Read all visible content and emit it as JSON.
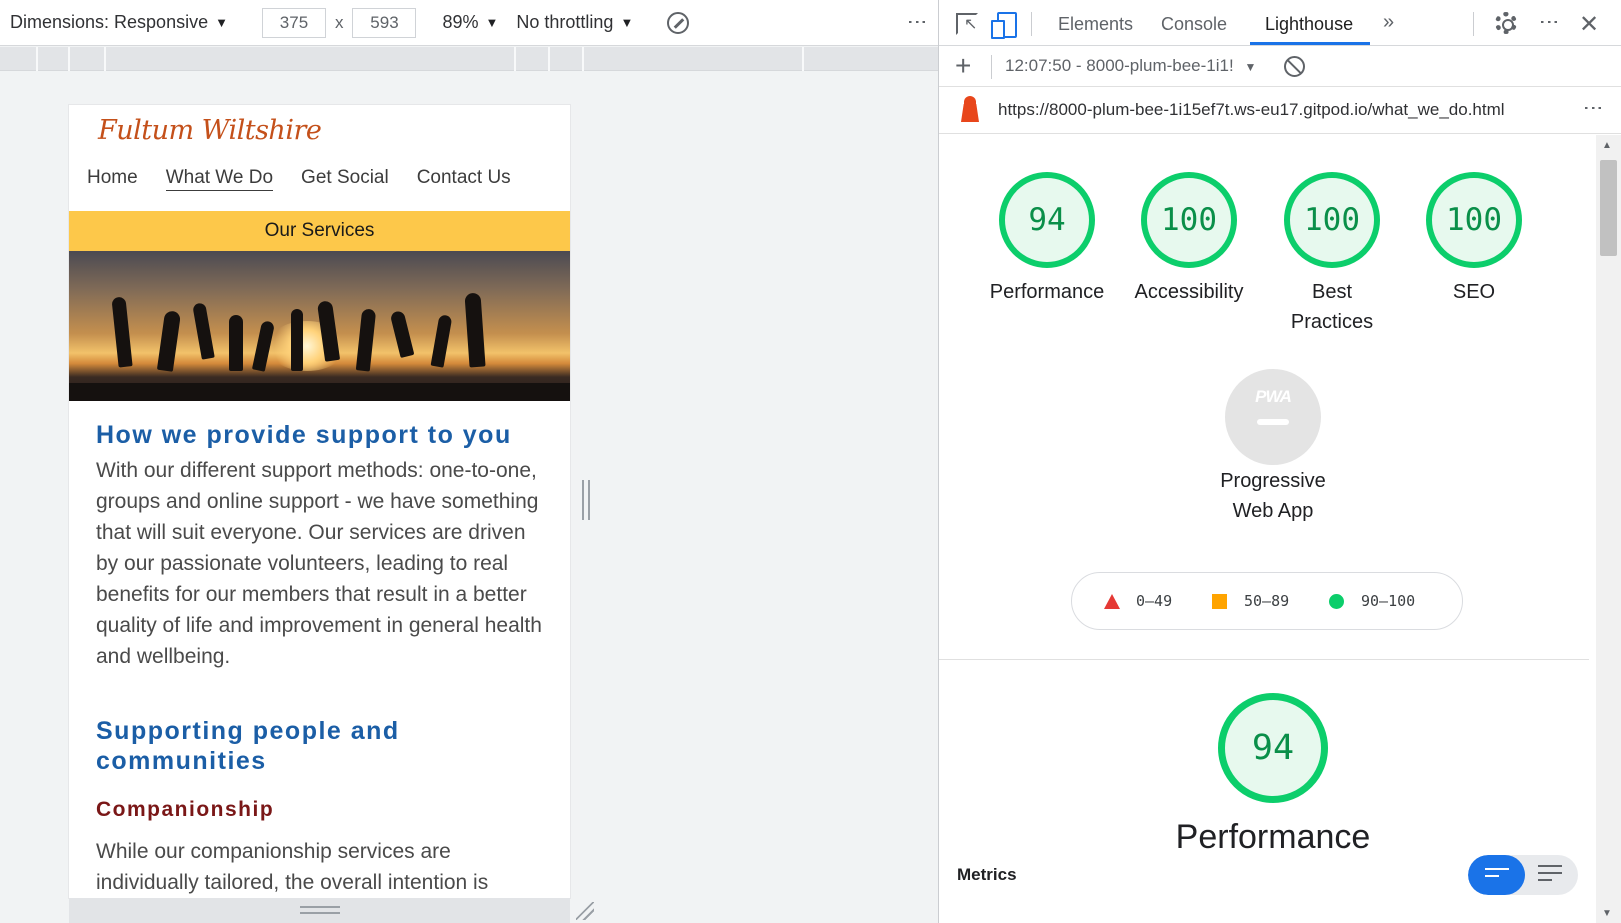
{
  "toolbar": {
    "dimensions_label": "Dimensions: Responsive",
    "width": "375",
    "times": "x",
    "height": "593",
    "zoom": "89%",
    "throttling": "No throttling",
    "caret": "▼",
    "more_icon": "⋮"
  },
  "site": {
    "brand": "Fultum Wiltshire",
    "nav": [
      "Home",
      "What We Do",
      "Get Social",
      "Contact Us"
    ],
    "active_nav": "What We Do",
    "section_banner": "Our Services",
    "heading_support": "How we provide support to you",
    "paragraph_support": "With our different support methods: one-to-one, groups and online support - we have something that will suit everyone. Our services are driven by our passionate volunteers, leading to real benefits for our members that result in a better quality of life and improvement in general health and wellbeing.",
    "heading_communities": "Supporting people and communities",
    "heading_companionship": "Companionship",
    "paragraph_companionship": "While our companionship services are individually tailored, the overall intention is"
  },
  "devtools": {
    "tabs": [
      "Elements",
      "Console",
      "Lighthouse"
    ],
    "active_tab": "Lighthouse",
    "more_tabs": "»",
    "close": "✕",
    "new_report": "+",
    "report_selector": "12:07:50 - 8000-plum-bee-1i1!",
    "url": "https://8000-plum-bee-1i15ef7t.ws-eu17.gitpod.io/what_we_do.html",
    "scores": [
      {
        "label": "Performance",
        "score": "94"
      },
      {
        "label": "Accessibility",
        "score": "100"
      },
      {
        "label": "Best Practices",
        "score": "100"
      },
      {
        "label": "SEO",
        "score": "100"
      }
    ],
    "pwa_badge": "PWA",
    "pwa_label": "Progressive Web App",
    "legend": [
      "0–49",
      "50–89",
      "90–100"
    ],
    "legend_colors": {
      "fail": "#e53935",
      "average": "#ffa400",
      "pass": "#0cce6b"
    },
    "section_score": "94",
    "section_title": "Performance",
    "metrics_label": "Metrics"
  }
}
